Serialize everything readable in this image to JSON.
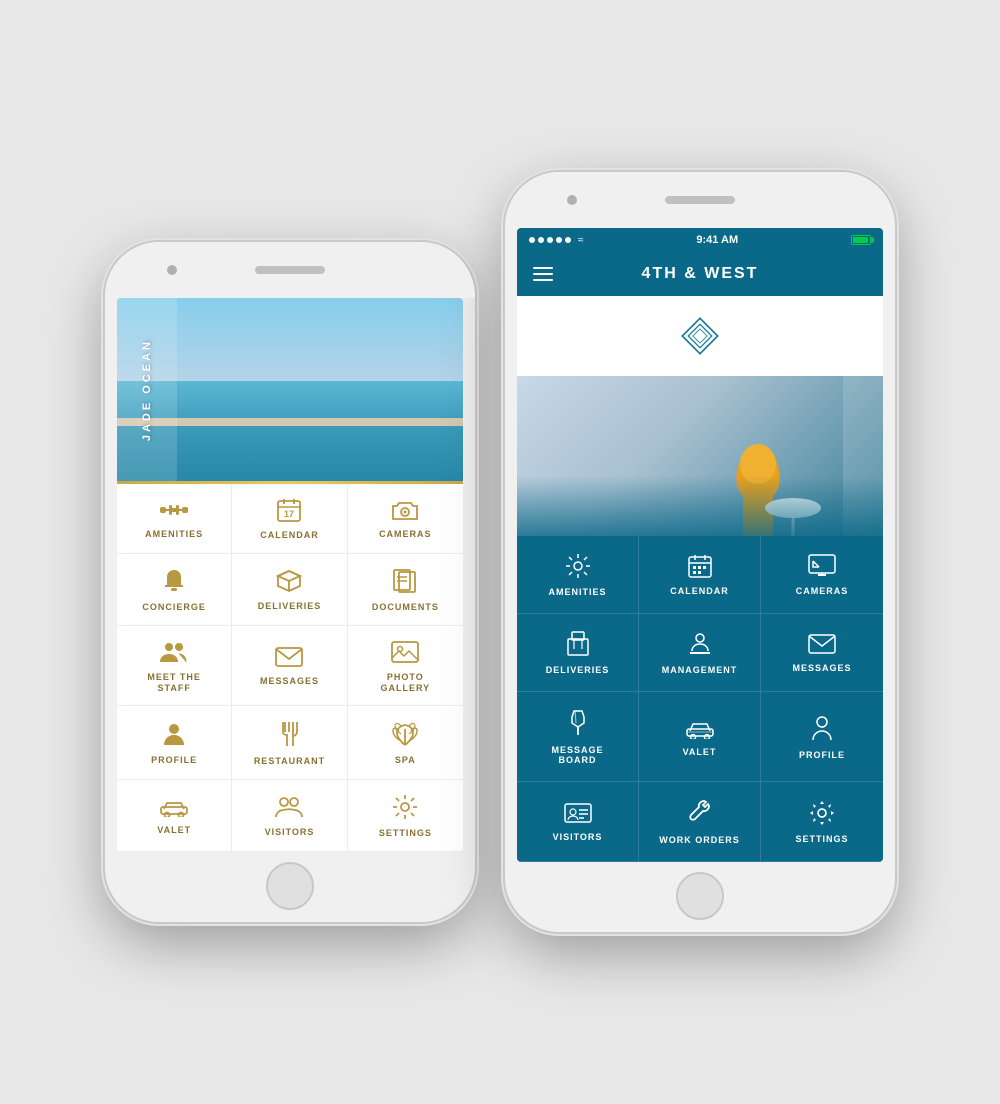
{
  "phone1": {
    "brand": "JADE OCEAN",
    "gold_divider": true,
    "menu_items": [
      {
        "id": "amenities",
        "label": "AMENITIES",
        "icon": "dumbbell"
      },
      {
        "id": "calendar",
        "label": "CALENDAR",
        "icon": "calendar"
      },
      {
        "id": "cameras",
        "label": "CAMERAS",
        "icon": "camera"
      },
      {
        "id": "concierge",
        "label": "CONCIERGE",
        "icon": "bell"
      },
      {
        "id": "deliveries",
        "label": "DELIVERIES",
        "icon": "box"
      },
      {
        "id": "documents",
        "label": "DOCUMENTS",
        "icon": "documents"
      },
      {
        "id": "meet_staff",
        "label": "MEET THE STAFF",
        "icon": "people"
      },
      {
        "id": "messages",
        "label": "MESSAGES",
        "icon": "envelope"
      },
      {
        "id": "photo_gallery",
        "label": "PHOTO GALLERY",
        "icon": "photo"
      },
      {
        "id": "profile",
        "label": "PROFILE",
        "icon": "person"
      },
      {
        "id": "restaurant",
        "label": "RESTAURANT",
        "icon": "fork_knife"
      },
      {
        "id": "spa",
        "label": "SPA",
        "icon": "lotus"
      },
      {
        "id": "valet",
        "label": "VALET",
        "icon": "car"
      },
      {
        "id": "visitors",
        "label": "VISITORS",
        "icon": "two_people"
      },
      {
        "id": "settings",
        "label": "SETTINGS",
        "icon": "sun"
      }
    ]
  },
  "phone2": {
    "status_bar": {
      "dots": 5,
      "wifi": true,
      "time": "9:41 AM",
      "battery": true
    },
    "nav_title": "4TH & WEST",
    "menu_items": [
      {
        "id": "amenities",
        "label": "AMENITIES",
        "icon": "sun_burst"
      },
      {
        "id": "calendar",
        "label": "CALENDAR",
        "icon": "calendar_grid"
      },
      {
        "id": "cameras",
        "label": "CAMERAS",
        "icon": "monitor"
      },
      {
        "id": "deliveries",
        "label": "DELIVERIES",
        "icon": "box_outline"
      },
      {
        "id": "management",
        "label": "MANAGEMENT",
        "icon": "person_desk"
      },
      {
        "id": "messages",
        "label": "MESSAGES",
        "icon": "envelope"
      },
      {
        "id": "message_board",
        "label": "MESSAGE BOARD",
        "icon": "pushpin"
      },
      {
        "id": "valet",
        "label": "VALET",
        "icon": "car_outline"
      },
      {
        "id": "profile",
        "label": "PROFILE",
        "icon": "person_circle"
      },
      {
        "id": "visitors",
        "label": "VISITORS",
        "icon": "id_card"
      },
      {
        "id": "work_orders",
        "label": "WORK ORDERS",
        "icon": "wrench"
      },
      {
        "id": "settings",
        "label": "SETTINGS",
        "icon": "gear"
      }
    ]
  }
}
